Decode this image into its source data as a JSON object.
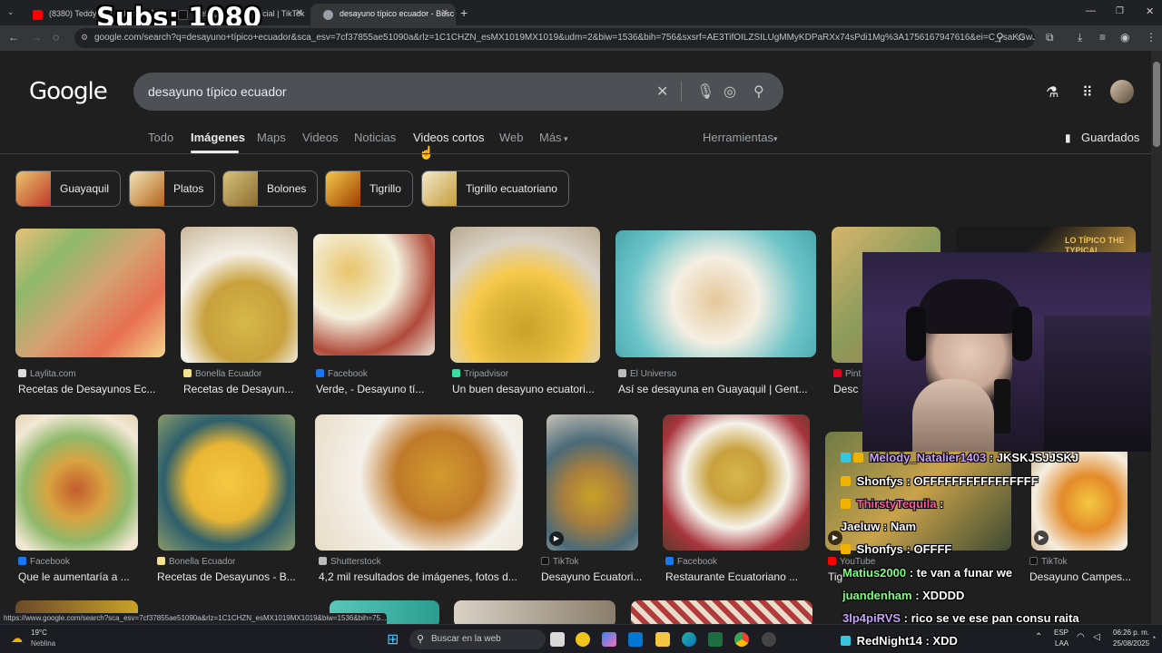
{
  "browser": {
    "tabs": [
      {
        "title": "(8380) Teddybear - Unkno",
        "favicon_color": "#ff0000"
      },
      {
        "title": "lbeltr@lbelbeor] oficial | TikTok",
        "favicon_color": "#000000"
      },
      {
        "title": "desayuno típico ecuador - Busc",
        "favicon_color": "#9aa0a6"
      }
    ],
    "new_tab": "+",
    "url": "google.com/search?q=desayuno+típico+ecuador&sca_esv=7cf37855ae51090a&rlz=1C1CHZN_esMX1019MX1019&udm=2&biw=1536&bih=756&sxsrf=AE3TifOILZSILUgMMyKDPaRXx74sPdi1Mg%3A1756167947616&ei=C_-saKGwJdPIkPI..."
  },
  "google": {
    "logo": "Google",
    "query": "desayuno típico ecuador",
    "nav": [
      "Todo",
      "Imágenes",
      "Maps",
      "Videos",
      "Noticias",
      "Videos cortos",
      "Web",
      "Más"
    ],
    "tools": "Herramientas",
    "saved": "Guardados",
    "chips": [
      "Guayaquil",
      "Platos",
      "Bolones",
      "Tigrillo",
      "Tigrillo ecuatoriano"
    ],
    "row1": [
      {
        "source": "Laylita.com",
        "title": "Recetas de Desayunos Ec..."
      },
      {
        "source": "Bonella Ecuador",
        "title": "Recetas de Desayun..."
      },
      {
        "source": "Facebook",
        "title": "Verde, - Desayuno tí..."
      },
      {
        "source": "Tripadvisor",
        "title": "Un buen desayuno ecuatori..."
      },
      {
        "source": "El Universo",
        "title": "Así se desayuna en Guayaquil | Gent..."
      },
      {
        "source": "Pint",
        "title": "Desc"
      }
    ],
    "row2": [
      {
        "source": "Facebook",
        "title": "Que le aumentaría a ..."
      },
      {
        "source": "Bonella Ecuador",
        "title": "Recetas de Desayunos - B..."
      },
      {
        "source": "Shutterstock",
        "title": "4,2 mil resultados de imágenes, fotos d..."
      },
      {
        "source": "TikTok",
        "title": "Desayuno Ecuatori..."
      },
      {
        "source": "Facebook",
        "title": "Restaurante Ecuatoriano ..."
      },
      {
        "source": "YouTube",
        "title": "Tig"
      },
      {
        "source": "TikTok",
        "title": "Desayuno Campes..."
      }
    ],
    "overlay_text": "LO TÍPICO THE TYPICAL",
    "status_url": "https://www.google.com/search?sca_esv=7cf37855ae51090a&rlz=1C1CHZN_esMX1019MX1019&biw=1536&bih=75..."
  },
  "stream": {
    "subs": "Subs: 1080",
    "chat": [
      {
        "user": "Melody_Natalier1403",
        "msg": " : JKSKJSJJSKJ",
        "color": "#c9a0ff"
      },
      {
        "user": "Shonfys",
        "msg": " : OFFFFFFFFFFFFFFFF",
        "color": "#ffffff"
      },
      {
        "user": "ThirstyTequila",
        "msg": " :",
        "color": "#ff5aa0"
      },
      {
        "user": "Jaeluw",
        "msg": " : Nam",
        "color": "#ffffff"
      },
      {
        "user": "Shonfys",
        "msg": " : OFFFF",
        "color": "#ffffff"
      },
      {
        "user": "Matius2000",
        "msg": " : te van a funar we",
        "color": "#7dff7d"
      },
      {
        "user": "juandenham",
        "msg": " : XDDDD",
        "color": "#7dff7d"
      },
      {
        "user": "3lp4piRVS",
        "msg": " : rico se ve ese pan consu raita",
        "color": "#c9a0ff"
      },
      {
        "user": "RedNight14",
        "msg": " : XDD",
        "color": "#ffffff"
      }
    ]
  },
  "taskbar": {
    "weather_temp": "19°C",
    "weather_desc": "Neblina",
    "search": "Buscar en la web",
    "lang_top": "ESP",
    "lang_bottom": "LAA",
    "time": "06:26 p. m.",
    "date": "25/08/2025"
  }
}
